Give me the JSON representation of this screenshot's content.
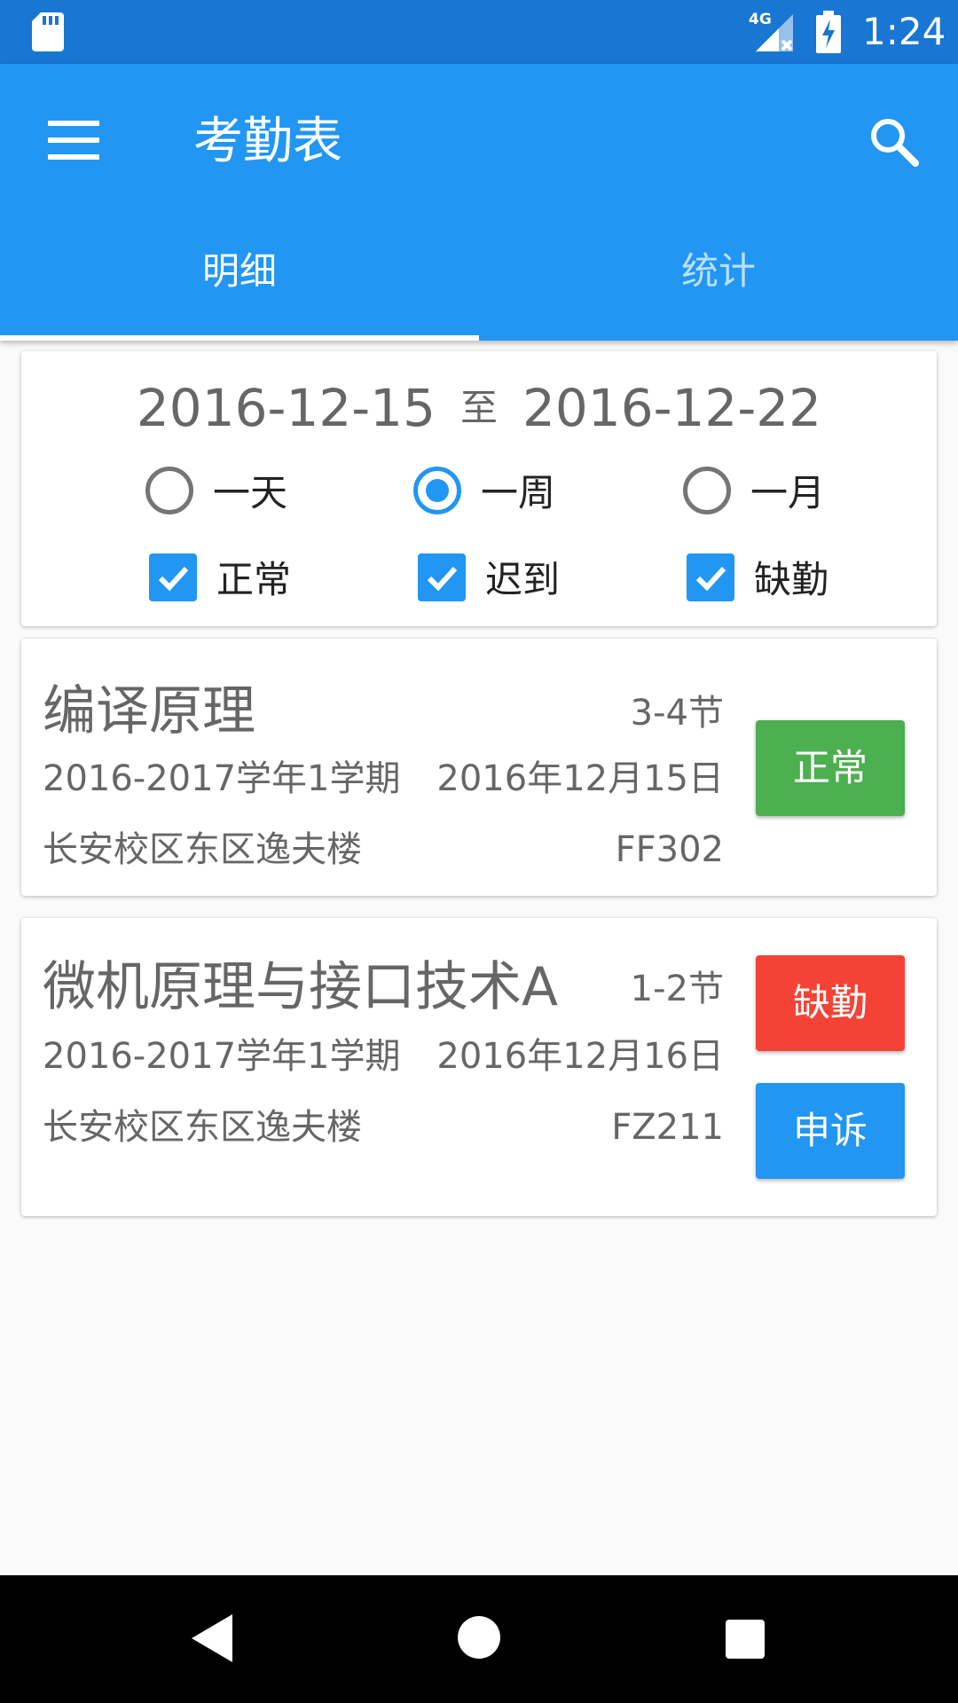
{
  "status_bar": {
    "time": "1:24",
    "network": "4G"
  },
  "app_bar": {
    "title": "考勤表"
  },
  "tabs": [
    {
      "label": "明细",
      "active": true
    },
    {
      "label": "统计",
      "active": false
    }
  ],
  "filter": {
    "start_date": "2016-12-15",
    "separator": "至",
    "end_date": "2016-12-22",
    "ranges": [
      {
        "label": "一天",
        "selected": false
      },
      {
        "label": "一周",
        "selected": true
      },
      {
        "label": "一月",
        "selected": false
      }
    ],
    "statuses": [
      {
        "label": "正常",
        "checked": true
      },
      {
        "label": "迟到",
        "checked": true
      },
      {
        "label": "缺勤",
        "checked": true
      }
    ]
  },
  "records": [
    {
      "course": "编译原理",
      "period": "3-4节",
      "term": "2016-2017学年1学期",
      "date": "2016年12月15日",
      "campus": "长安校区东区逸夫楼",
      "room": "FF302",
      "status_label": "正常"
    },
    {
      "course": "微机原理与接口技术A",
      "period": "1-2节",
      "term": "2016-2017学年1学期",
      "date": "2016年12月16日",
      "campus": "长安校区东区逸夫楼",
      "room": "FZ211",
      "status_label": "缺勤",
      "action_label": "申诉"
    }
  ],
  "colors": {
    "status_bar": "#1976d2",
    "primary": "#2196f3",
    "normal": "#4caf50",
    "absent": "#f44336"
  },
  "icons": {
    "status": [
      "sd-card-icon",
      "signal-icon",
      "battery-charging-icon"
    ],
    "app_bar": [
      "menu-icon",
      "search-icon"
    ],
    "nav": [
      "back-icon",
      "home-icon",
      "recents-icon"
    ]
  }
}
